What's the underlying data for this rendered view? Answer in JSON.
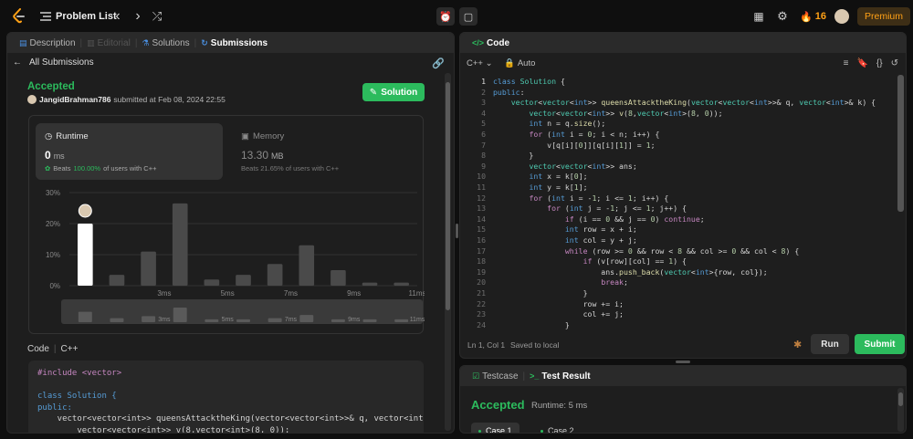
{
  "topbar": {
    "title": "Problem List",
    "streak": "16",
    "premium": "Premium",
    "icons": [
      "leetcode-logo-icon",
      "list-icon",
      "chevron-left-icon",
      "chevron-right-icon",
      "shuffle-icon",
      "timer-icon",
      "note-icon",
      "layout-icon",
      "gear-icon",
      "fire-icon"
    ]
  },
  "left_tabs": {
    "description": "Description",
    "editorial": "Editorial",
    "solutions": "Solutions",
    "submissions": "Submissions"
  },
  "submission": {
    "back_label": "All Submissions",
    "status": "Accepted",
    "user": "JangidBrahman786",
    "submitted_text": "submitted at Feb 08, 2024 22:55",
    "solution_button": "Solution"
  },
  "runtime": {
    "title": "Runtime",
    "value": "0",
    "unit": "ms",
    "beats_prefix": "Beats",
    "beats_pct": "100.00%",
    "beats_suffix": "of users with C++"
  },
  "memory": {
    "title": "Memory",
    "value": "13.30",
    "unit": "MB",
    "beats_text": "Beats 21.65% of users with C++"
  },
  "chart_data": {
    "type": "bar",
    "y_ticks": [
      "30%",
      "20%",
      "10%",
      "0%"
    ],
    "ylim": [
      0,
      30
    ],
    "x_tick_labels": [
      {
        "index": 3,
        "label": "3ms"
      },
      {
        "index": 5,
        "label": "5ms"
      },
      {
        "index": 7,
        "label": "7ms"
      },
      {
        "index": 9,
        "label": "9ms"
      },
      {
        "index": 11,
        "label": "11ms"
      }
    ],
    "values": [
      20,
      3.5,
      11,
      26.5,
      2,
      3.5,
      7,
      13,
      5,
      1,
      1
    ],
    "highlight_index": 0,
    "overview_values": [
      4,
      1,
      2,
      6,
      0.5,
      0.5,
      1,
      2.5,
      0.5,
      0.5,
      0.5
    ],
    "highlight_color": "#ffffff",
    "bar_color": "#4a4a4a"
  },
  "code_section": {
    "label": "Code",
    "lang": "C++",
    "snippet": [
      "#include <vector>",
      "",
      "class Solution {",
      "public:",
      "    vector<vector<int>> queensAttacktheKing(vector<vector<int>>& q, vector<int>&",
      "        vector<vector<int>> v(8,vector<int>(8, 0));"
    ]
  },
  "editor": {
    "tab": "Code",
    "lang": "C++",
    "mode": "Auto",
    "cursor": "Ln 1, Col 1",
    "saved": "Saved to local",
    "run": "Run",
    "submit": "Submit",
    "current_line": 1,
    "line_numbers": [
      "1",
      "2",
      "3",
      "4",
      "5",
      "6",
      "7",
      "8",
      "9",
      "10",
      "11",
      "12",
      "13",
      "14",
      "15",
      "16",
      "17",
      "18",
      "19",
      "20",
      "21",
      "22",
      "23",
      "24"
    ]
  },
  "test": {
    "testcase_tab": "Testcase",
    "result_tab": "Test Result",
    "status": "Accepted",
    "runtime": "Runtime: 5 ms",
    "case1": "Case 1",
    "case2": "Case 2"
  }
}
